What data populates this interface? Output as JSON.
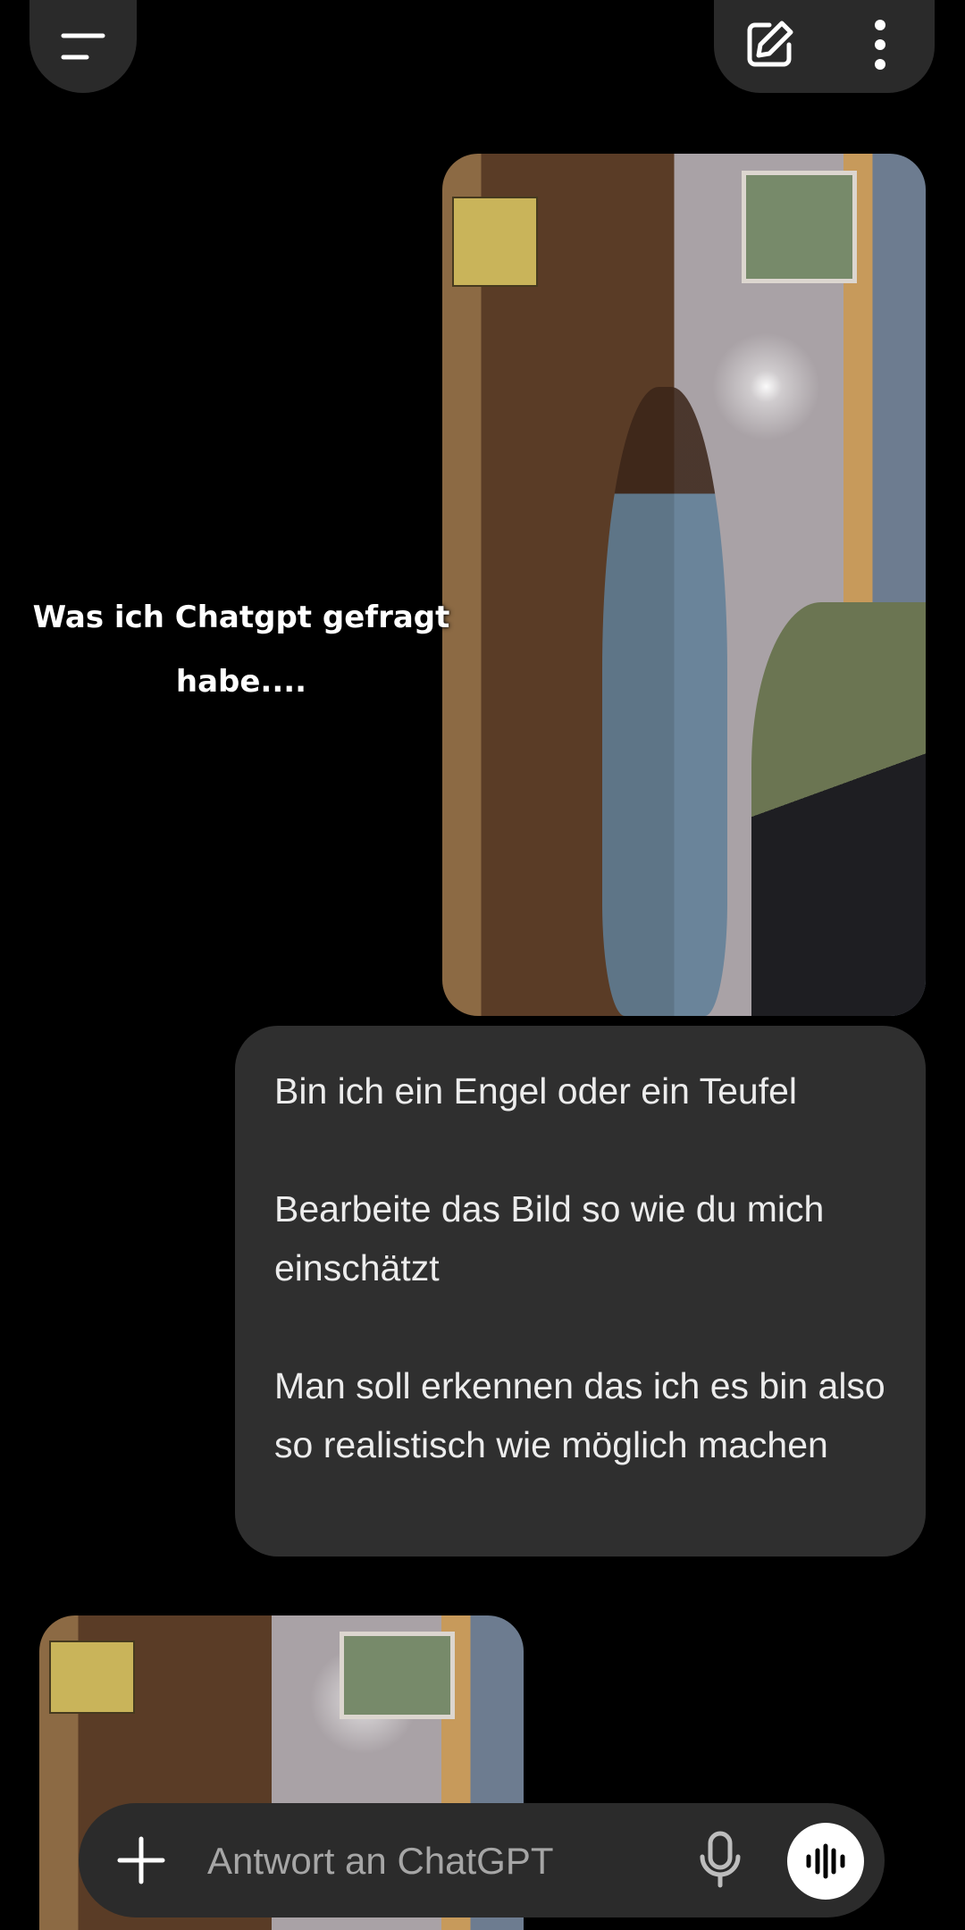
{
  "header": {
    "menu_icon": "hamburger-menu-icon",
    "edit_icon": "new-chat-edit-icon",
    "more_icon": "vertical-dots-icon"
  },
  "overlay": {
    "caption": "Was ich Chatgpt gefragt\nhabe...."
  },
  "conversation": {
    "user_message": {
      "paragraphs": [
        "Bin ich ein Engel oder ein Teufel",
        "Bearbeite das Bild so wie du mich einschätzt",
        "Man soll erkennen das ich es bin also so realistisch wie möglich machen"
      ]
    }
  },
  "composer": {
    "placeholder": "Antwort an ChatGPT",
    "plus_icon": "plus-icon",
    "mic_icon": "microphone-icon",
    "voice_icon": "voice-mode-icon"
  },
  "colors": {
    "background": "#000000",
    "bubble": "#2f2f2f",
    "control": "#2a2a2a"
  }
}
